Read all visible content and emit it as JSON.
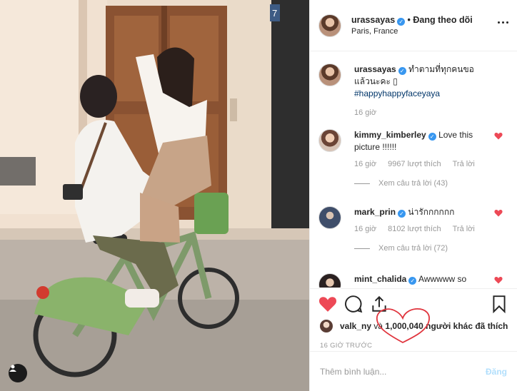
{
  "post": {
    "username": "urassayas",
    "follow_text": "• Đang theo dõi",
    "location": "Paris, France",
    "caption": "ทำตามที่ทุกคนขอแล้วนะคะ ▯",
    "hashtag": "#happyhappyfaceyaya",
    "caption_time": "16 giờ",
    "photo_number": "7"
  },
  "comments": [
    {
      "username": "kimmy_kimberley",
      "text": "Love this picture !!!!!!",
      "time": "16 giờ",
      "likes": "9967 lượt thích",
      "reply": "Trả lời",
      "view_replies": "Xem câu trả lời (43)"
    },
    {
      "username": "mark_prin",
      "text": "น่ารักกกกกก",
      "time": "16 giờ",
      "likes": "8102 lượt thích",
      "reply": "Trả lời",
      "view_replies": "Xem câu trả lời (72)"
    },
    {
      "username": "mint_chalida",
      "text": "Awwwww so"
    }
  ],
  "likes": {
    "liker": "valk_ny",
    "joiner": " và ",
    "count": "1,000,040",
    "suffix": " người khác đã thích"
  },
  "timestamp": "16 GIỜ TRƯỚC",
  "comment_input": {
    "placeholder": "Thêm bình luận...",
    "post_label": "Đăng"
  },
  "icons": {
    "like": "heart-filled-icon",
    "comment": "comment-bubble-icon",
    "share": "share-icon",
    "save": "bookmark-icon",
    "more": "more-dots-icon"
  },
  "colors": {
    "like_red": "#ed4956",
    "verified_blue": "#3897f0",
    "hashtag_blue": "#003569",
    "annotation_red": "#e0343d"
  }
}
